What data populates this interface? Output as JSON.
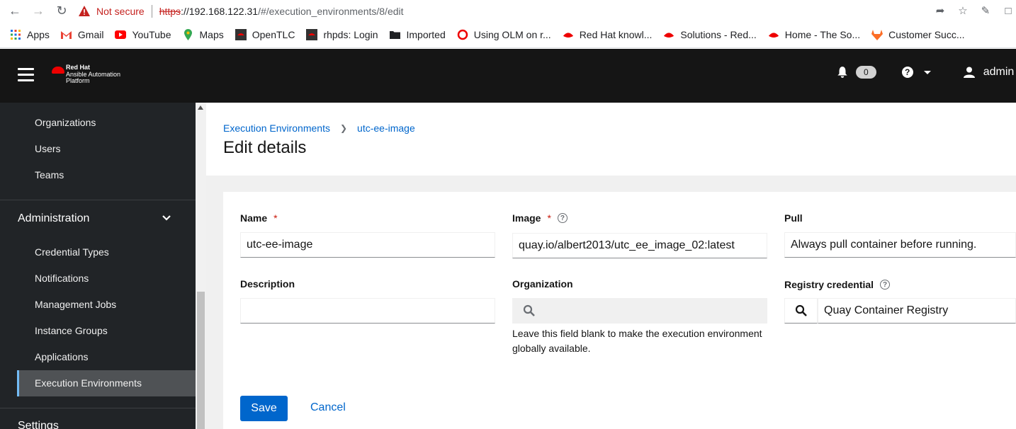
{
  "browser": {
    "not_secure": "Not secure",
    "url_scheme": "https",
    "url_host": "://192.168.122.31",
    "url_path": "/#/execution_environments/8/edit"
  },
  "bookmarks": [
    {
      "label": "Apps",
      "icon": "apps-grid-icon"
    },
    {
      "label": "Gmail",
      "icon": "gmail-icon"
    },
    {
      "label": "YouTube",
      "icon": "youtube-icon"
    },
    {
      "label": "Maps",
      "icon": "maps-icon"
    },
    {
      "label": "OpenTLC",
      "icon": "redhat-icon"
    },
    {
      "label": "rhpds: Login",
      "icon": "redhat-icon"
    },
    {
      "label": "Imported",
      "icon": "folder-icon"
    },
    {
      "label": "Using OLM on r...",
      "icon": "openshift-icon"
    },
    {
      "label": "Red Hat knowl...",
      "icon": "redhat-hat-icon"
    },
    {
      "label": "Solutions - Red...",
      "icon": "redhat-hat-icon"
    },
    {
      "label": "Home - The So...",
      "icon": "redhat-hat-icon"
    },
    {
      "label": "Customer Succ...",
      "icon": "gitlab-icon"
    }
  ],
  "header": {
    "logo_line1": "Red Hat",
    "logo_line2": "Ansible Automation",
    "logo_line3": "Platform",
    "notification_count": "0",
    "user": "admin"
  },
  "sidebar": {
    "access_items": [
      "Organizations",
      "Users",
      "Teams"
    ],
    "admin_group": "Administration",
    "admin_items": [
      "Credential Types",
      "Notifications",
      "Management Jobs",
      "Instance Groups",
      "Applications",
      "Execution Environments"
    ],
    "settings_group": "Settings"
  },
  "breadcrumb": {
    "parent": "Execution Environments",
    "current": "utc-ee-image"
  },
  "page_title": "Edit details",
  "form": {
    "name_label": "Name",
    "name_value": "utc-ee-image",
    "image_label": "Image",
    "image_value": "quay.io/albert2013/utc_ee_image_02:latest",
    "pull_label": "Pull",
    "pull_value": "Always pull container before running.",
    "description_label": "Description",
    "description_value": "",
    "organization_label": "Organization",
    "organization_value": "",
    "organization_help_line1": "Leave this field blank to make the execution environment",
    "organization_help_line2": "globally available.",
    "registry_label": "Registry credential",
    "registry_value": "Quay Container Registry",
    "required_mark": "*",
    "help_mark": "?"
  },
  "actions": {
    "save": "Save",
    "cancel": "Cancel"
  },
  "colors": {
    "primary": "#0066cc",
    "header_bg": "#151515",
    "sidebar_bg": "#212427",
    "required": "#c9190b"
  }
}
